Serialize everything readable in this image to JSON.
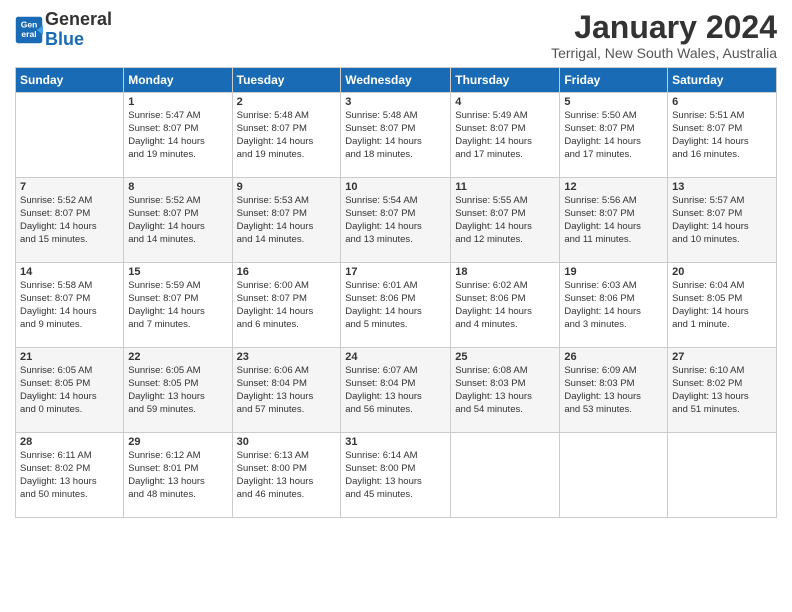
{
  "header": {
    "logo_line1": "General",
    "logo_line2": "Blue",
    "title": "January 2024",
    "subtitle": "Terrigal, New South Wales, Australia"
  },
  "days_of_week": [
    "Sunday",
    "Monday",
    "Tuesday",
    "Wednesday",
    "Thursday",
    "Friday",
    "Saturday"
  ],
  "weeks": [
    [
      {
        "num": "",
        "info": ""
      },
      {
        "num": "1",
        "info": "Sunrise: 5:47 AM\nSunset: 8:07 PM\nDaylight: 14 hours\nand 19 minutes."
      },
      {
        "num": "2",
        "info": "Sunrise: 5:48 AM\nSunset: 8:07 PM\nDaylight: 14 hours\nand 19 minutes."
      },
      {
        "num": "3",
        "info": "Sunrise: 5:48 AM\nSunset: 8:07 PM\nDaylight: 14 hours\nand 18 minutes."
      },
      {
        "num": "4",
        "info": "Sunrise: 5:49 AM\nSunset: 8:07 PM\nDaylight: 14 hours\nand 17 minutes."
      },
      {
        "num": "5",
        "info": "Sunrise: 5:50 AM\nSunset: 8:07 PM\nDaylight: 14 hours\nand 17 minutes."
      },
      {
        "num": "6",
        "info": "Sunrise: 5:51 AM\nSunset: 8:07 PM\nDaylight: 14 hours\nand 16 minutes."
      }
    ],
    [
      {
        "num": "7",
        "info": "Sunrise: 5:52 AM\nSunset: 8:07 PM\nDaylight: 14 hours\nand 15 minutes."
      },
      {
        "num": "8",
        "info": "Sunrise: 5:52 AM\nSunset: 8:07 PM\nDaylight: 14 hours\nand 14 minutes."
      },
      {
        "num": "9",
        "info": "Sunrise: 5:53 AM\nSunset: 8:07 PM\nDaylight: 14 hours\nand 14 minutes."
      },
      {
        "num": "10",
        "info": "Sunrise: 5:54 AM\nSunset: 8:07 PM\nDaylight: 14 hours\nand 13 minutes."
      },
      {
        "num": "11",
        "info": "Sunrise: 5:55 AM\nSunset: 8:07 PM\nDaylight: 14 hours\nand 12 minutes."
      },
      {
        "num": "12",
        "info": "Sunrise: 5:56 AM\nSunset: 8:07 PM\nDaylight: 14 hours\nand 11 minutes."
      },
      {
        "num": "13",
        "info": "Sunrise: 5:57 AM\nSunset: 8:07 PM\nDaylight: 14 hours\nand 10 minutes."
      }
    ],
    [
      {
        "num": "14",
        "info": "Sunrise: 5:58 AM\nSunset: 8:07 PM\nDaylight: 14 hours\nand 9 minutes."
      },
      {
        "num": "15",
        "info": "Sunrise: 5:59 AM\nSunset: 8:07 PM\nDaylight: 14 hours\nand 7 minutes."
      },
      {
        "num": "16",
        "info": "Sunrise: 6:00 AM\nSunset: 8:07 PM\nDaylight: 14 hours\nand 6 minutes."
      },
      {
        "num": "17",
        "info": "Sunrise: 6:01 AM\nSunset: 8:06 PM\nDaylight: 14 hours\nand 5 minutes."
      },
      {
        "num": "18",
        "info": "Sunrise: 6:02 AM\nSunset: 8:06 PM\nDaylight: 14 hours\nand 4 minutes."
      },
      {
        "num": "19",
        "info": "Sunrise: 6:03 AM\nSunset: 8:06 PM\nDaylight: 14 hours\nand 3 minutes."
      },
      {
        "num": "20",
        "info": "Sunrise: 6:04 AM\nSunset: 8:05 PM\nDaylight: 14 hours\nand 1 minute."
      }
    ],
    [
      {
        "num": "21",
        "info": "Sunrise: 6:05 AM\nSunset: 8:05 PM\nDaylight: 14 hours\nand 0 minutes."
      },
      {
        "num": "22",
        "info": "Sunrise: 6:05 AM\nSunset: 8:05 PM\nDaylight: 13 hours\nand 59 minutes."
      },
      {
        "num": "23",
        "info": "Sunrise: 6:06 AM\nSunset: 8:04 PM\nDaylight: 13 hours\nand 57 minutes."
      },
      {
        "num": "24",
        "info": "Sunrise: 6:07 AM\nSunset: 8:04 PM\nDaylight: 13 hours\nand 56 minutes."
      },
      {
        "num": "25",
        "info": "Sunrise: 6:08 AM\nSunset: 8:03 PM\nDaylight: 13 hours\nand 54 minutes."
      },
      {
        "num": "26",
        "info": "Sunrise: 6:09 AM\nSunset: 8:03 PM\nDaylight: 13 hours\nand 53 minutes."
      },
      {
        "num": "27",
        "info": "Sunrise: 6:10 AM\nSunset: 8:02 PM\nDaylight: 13 hours\nand 51 minutes."
      }
    ],
    [
      {
        "num": "28",
        "info": "Sunrise: 6:11 AM\nSunset: 8:02 PM\nDaylight: 13 hours\nand 50 minutes."
      },
      {
        "num": "29",
        "info": "Sunrise: 6:12 AM\nSunset: 8:01 PM\nDaylight: 13 hours\nand 48 minutes."
      },
      {
        "num": "30",
        "info": "Sunrise: 6:13 AM\nSunset: 8:00 PM\nDaylight: 13 hours\nand 46 minutes."
      },
      {
        "num": "31",
        "info": "Sunrise: 6:14 AM\nSunset: 8:00 PM\nDaylight: 13 hours\nand 45 minutes."
      },
      {
        "num": "",
        "info": ""
      },
      {
        "num": "",
        "info": ""
      },
      {
        "num": "",
        "info": ""
      }
    ]
  ]
}
